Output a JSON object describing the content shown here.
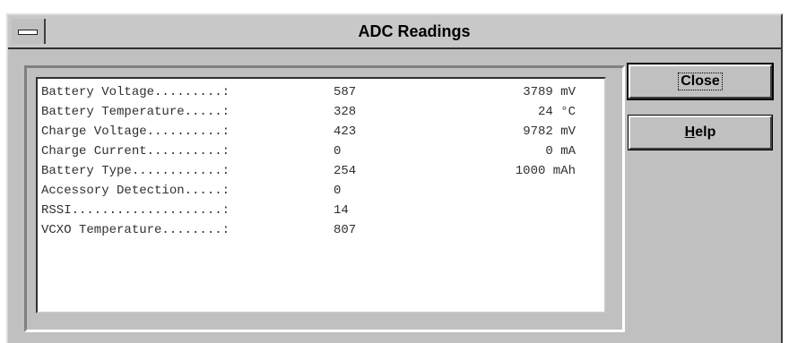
{
  "window": {
    "title": "ADC Readings"
  },
  "readings": [
    {
      "label": "Battery Voltage.........:",
      "raw": "587",
      "value": "3789 mV"
    },
    {
      "label": "Battery Temperature.....:",
      "raw": "328",
      "value": "24 °C"
    },
    {
      "label": "Charge Voltage..........:",
      "raw": "423",
      "value": "9782 mV"
    },
    {
      "label": "Charge Current..........:",
      "raw": "0",
      "value": "0 mA"
    },
    {
      "label": "Battery Type............:",
      "raw": "254",
      "value": "1000 mAh"
    },
    {
      "label": "Accessory Detection.....:",
      "raw": "0",
      "value": ""
    },
    {
      "label": "RSSI....................:",
      "raw": "14",
      "value": ""
    },
    {
      "label": "VCXO Temperature........:",
      "raw": "807",
      "value": ""
    }
  ],
  "buttons": {
    "close_label": "Close",
    "help_label_underlined": "H",
    "help_label_rest": "elp"
  }
}
